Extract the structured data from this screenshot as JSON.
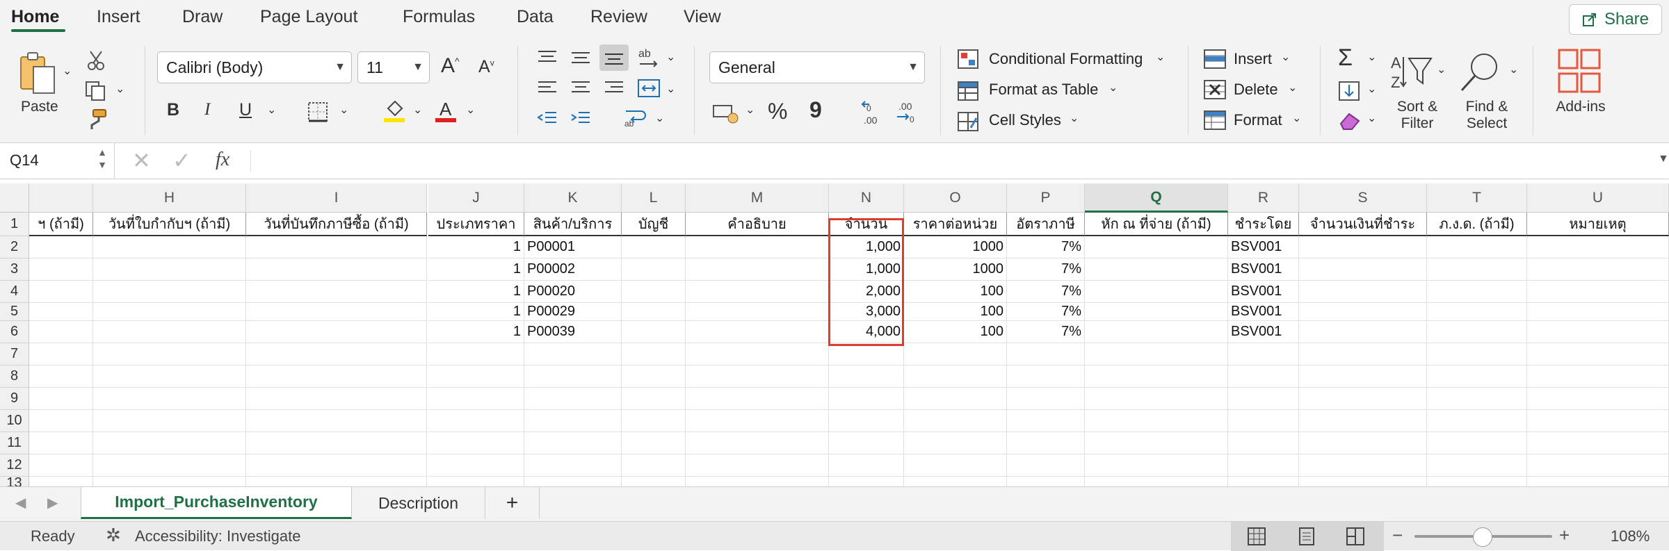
{
  "menu": {
    "tabs": [
      "Home",
      "Insert",
      "Draw",
      "Page Layout",
      "Formulas",
      "Data",
      "Review",
      "View"
    ],
    "share": "Share"
  },
  "ribbon": {
    "paste": "Paste",
    "font_name": "Calibri (Body)",
    "font_size": "11",
    "bold": "B",
    "italic": "I",
    "underline": "U",
    "number_format": "General",
    "percent": "%",
    "comma": "9",
    "inc_decimal": ".00",
    "dec_decimal": ".00",
    "conditional_formatting": "Conditional Formatting",
    "format_as_table": "Format as Table",
    "cell_styles": "Cell Styles",
    "insert": "Insert",
    "delete": "Delete",
    "format": "Format",
    "sort_filter": [
      "Sort &",
      "Filter"
    ],
    "find_select": [
      "Find &",
      "Select"
    ],
    "add_ins": "Add-ins"
  },
  "formula_bar": {
    "name_box": "Q14",
    "fx": "fx",
    "value": ""
  },
  "sheet": {
    "columns": [
      "H",
      "I",
      "J",
      "K",
      "L",
      "M",
      "N",
      "O",
      "P",
      "Q",
      "R",
      "S",
      "T",
      "U"
    ],
    "selected_column": "Q",
    "row_numbers": [
      "1",
      "2",
      "3",
      "4",
      "5",
      "6",
      "7",
      "8",
      "9",
      "10",
      "11",
      "12",
      "13"
    ],
    "headers": [
      "ฯ (ถ้ามี)",
      "วันที่ใบกำกับฯ (ถ้ามี)",
      "วันที่บันทึกภาษีซื้อ (ถ้ามี)",
      "ประเภทราคา",
      "สินค้า/บริการ",
      "บัญชี",
      "คำอธิบาย",
      "จำนวน",
      "ราคาต่อหน่วย",
      "อัตราภาษี",
      "หัก ณ ที่จ่าย (ถ้ามี)",
      "ชำระโดย",
      "จำนวนเงินที่ชำระ",
      "ภ.ง.ด. (ถ้ามี)",
      "หมายเหตุ"
    ],
    "rows": [
      {
        "J": "1",
        "K": "P00001",
        "N": "1,000",
        "O": "1000",
        "P": "7%",
        "R": "BSV001"
      },
      {
        "J": "1",
        "K": "P00002",
        "N": "1,000",
        "O": "1000",
        "P": "7%",
        "R": "BSV001"
      },
      {
        "J": "1",
        "K": "P00020",
        "N": "2,000",
        "O": "100",
        "P": "7%",
        "R": "BSV001"
      },
      {
        "J": "1",
        "K": "P00029",
        "N": "3,000",
        "O": "100",
        "P": "7%",
        "R": "BSV001"
      },
      {
        "J": "1",
        "K": "P00039",
        "N": "4,000",
        "O": "100",
        "P": "7%",
        "R": "BSV001"
      }
    ]
  },
  "sheet_tabs": {
    "active": "Import_PurchaseInventory",
    "other": "Description",
    "add": "+"
  },
  "status": {
    "ready": "Ready",
    "accessibility": "Accessibility: Investigate",
    "zoom": "108%"
  },
  "colors": {
    "accent": "#1e7145",
    "highlight": "#e13b2b"
  }
}
